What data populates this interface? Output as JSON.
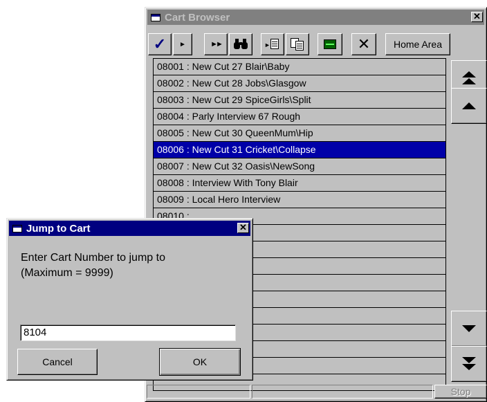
{
  "browser": {
    "title": "Cart Browser",
    "close_glyph": "✕",
    "toolbar": {
      "check_glyph": "✓",
      "play_glyph": "►",
      "ffwd_glyph": "►►",
      "find_glyph": "🔍",
      "home_area_label": "Home Area",
      "delete_glyph": "✕"
    },
    "rows": [
      "08001 : New Cut 27 Blair\\Baby",
      "08002 : New Cut 28 Jobs\\Glasgow",
      "08003 : New Cut 29 SpiceGirls\\Split",
      "08004 : Parly Interview 67 Rough",
      "08005 : New Cut 30 QueenMum\\Hip",
      "08006 : New Cut 31 Cricket\\Collapse",
      "08007 : New Cut 32 Oasis\\NewSong",
      "08008 : Interview With Tony Blair",
      "08009 : Local Hero Interview",
      "08010 :",
      "",
      "",
      "",
      "",
      "",
      "",
      "",
      "",
      "",
      ""
    ],
    "selected_index": 5,
    "stop_label": "Stop",
    "colors": {
      "selection": "#0000a8",
      "active_title": "#000080",
      "inactive_title": "#808080",
      "face": "#c0c0c0"
    }
  },
  "dialog": {
    "title": "Jump to Cart",
    "close_glyph": "✕",
    "prompt_line1": "Enter Cart Number to jump to",
    "prompt_line2": "(Maximum = 9999)",
    "input_value": "8104",
    "cancel_label": "Cancel",
    "ok_label": "OK"
  }
}
